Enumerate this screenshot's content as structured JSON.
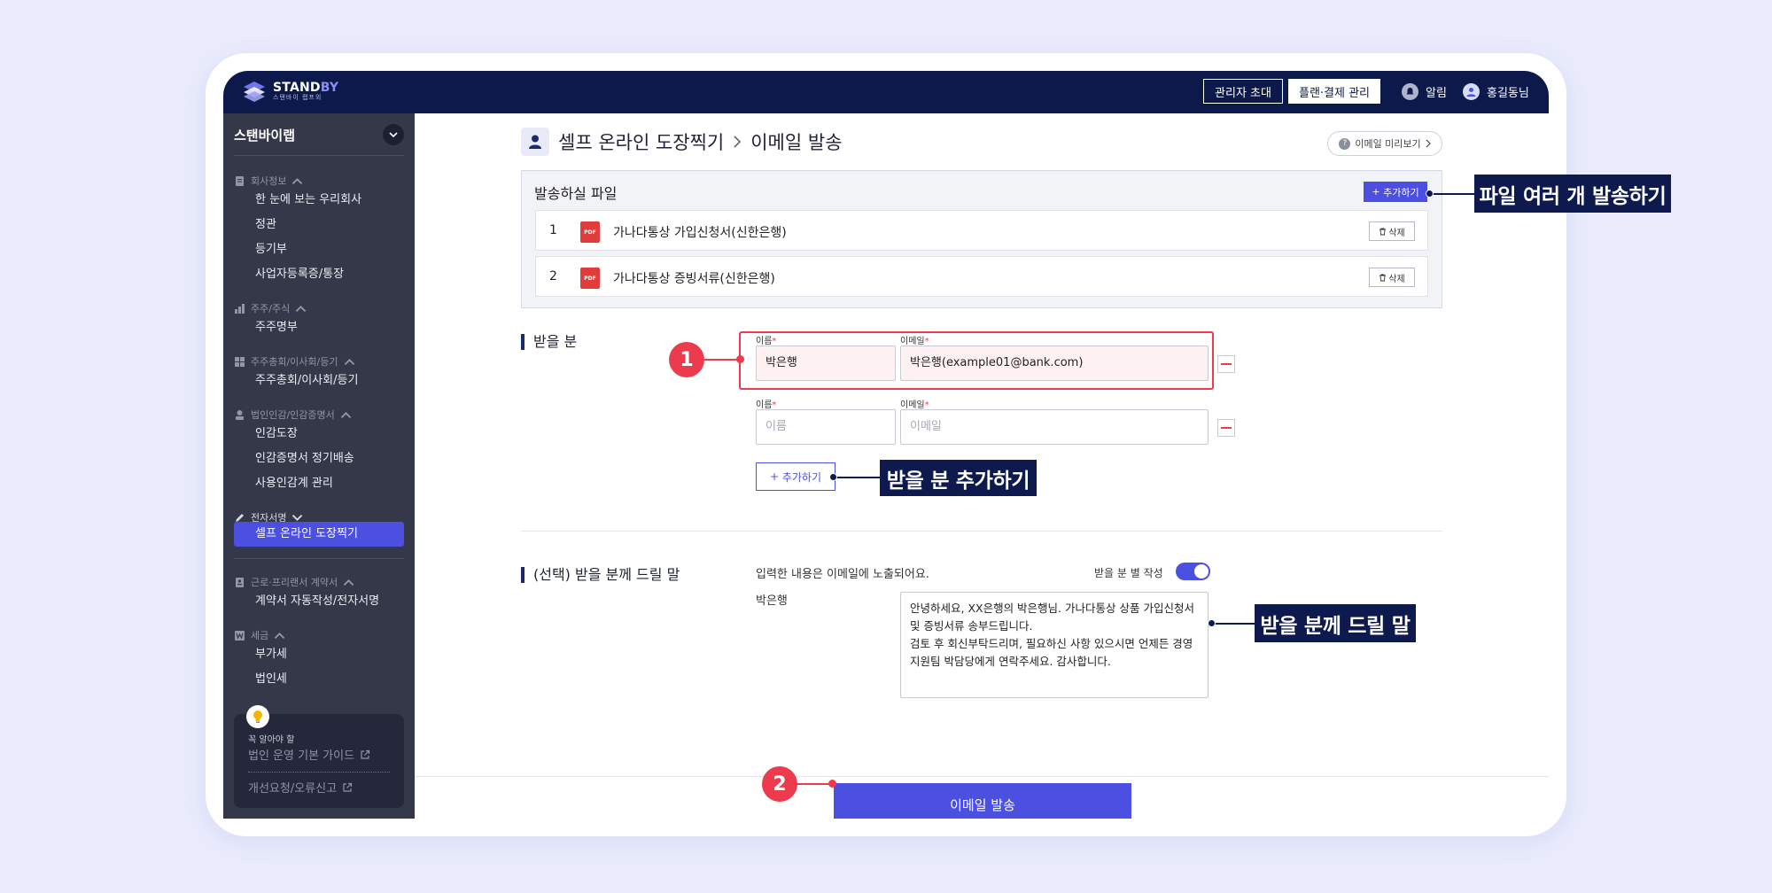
{
  "topbar": {
    "logo_main": "STAND",
    "logo_accent": "BY",
    "logo_sub": "스탠바이 랩프외",
    "invite_label": "관리자 초대",
    "plan_label": "플랜·결제 관리",
    "alert_label": "알림",
    "user_label": "홍길동님"
  },
  "sidebar": {
    "company": "스탠바이랩",
    "sections": [
      {
        "label": "회사정보",
        "icon": "document-icon",
        "items": [
          "한 눈에 보는 우리회사",
          "정관",
          "등기부",
          "사업자등록증/통장"
        ]
      },
      {
        "label": "주주/주식",
        "icon": "bar-chart-icon",
        "items": [
          "주주명부"
        ]
      },
      {
        "label": "주주총회/이사회/등기",
        "icon": "grid-icon",
        "items": [
          "주주총회/이사회/등기"
        ]
      },
      {
        "label": "법인인감/인감증명서",
        "icon": "person-icon",
        "items": [
          "인감도장",
          "인감증명서 정기배송",
          "사용인감계 관리"
        ]
      },
      {
        "label": "전자서명",
        "icon": "pen-icon",
        "items": [
          "셀프 온라인 도장찍기"
        ]
      },
      {
        "label": "근로·프리랜서 계약서",
        "icon": "contract-icon",
        "items": [
          "계약서 자동작성/전자서명"
        ]
      },
      {
        "label": "세금",
        "icon": "tax-icon",
        "items": [
          "부가세",
          "법인세"
        ]
      }
    ],
    "tip_small": "꼭 알아야 할",
    "tip_link": "법인 운영 기본 가이드",
    "report_link": "개선요청/오류신고"
  },
  "main": {
    "breadcrumb_1": "셀프 온라인 도장찍기",
    "breadcrumb_2": "이메일 발송",
    "preview_label": "이메일 미리보기",
    "files_title": "발송하실 파일",
    "add_label": "추가하기",
    "delete_label": "삭제",
    "files": [
      {
        "num": "1",
        "name": "가나다통상 가입신청서(신한은행)"
      },
      {
        "num": "2",
        "name": "가나다통상 증빙서류(신한은행)"
      }
    ],
    "recipients_title": "받을 분",
    "name_label": "이름",
    "email_label": "이메일",
    "required_mark": "*",
    "recipient_1_name": "박은행",
    "recipient_1_email": "박은행(example01@bank.com)",
    "name_placeholder": "이름",
    "email_placeholder": "이메일",
    "add_recipient_label": "추가하기",
    "message_title": "(선택) 받을 분께 드릴 말",
    "message_hint": "입력한 내용은 이메일에 노출되어요.",
    "toggle_label": "받을 분 별 작성",
    "toggle_on": true,
    "message_recipient": "박은행",
    "message_body": "안녕하세요, XX은행의 박은행님. 가나다통상 상품 가입신청서 및 증빙서류 송부드립니다.\n검토 후 회신부탁드리며, 필요하신 사항 있으시면 언제든 경영지원팀 박담당에게 연락주세요. 감사합니다.",
    "send_label": "이메일 발송"
  },
  "annotations": {
    "multi_file": "파일 여러 개 발송하기",
    "add_recipient": "받을 분 추가하기",
    "message": "받을 분께 드릴 말",
    "step_1": "1",
    "step_2": "2"
  },
  "colors": {
    "navy": "#0c1a4b",
    "accent": "#4c50e0",
    "sidebar": "#343849",
    "highlight_red": "#ec3b4d",
    "page_bg": "#eaecfd"
  }
}
